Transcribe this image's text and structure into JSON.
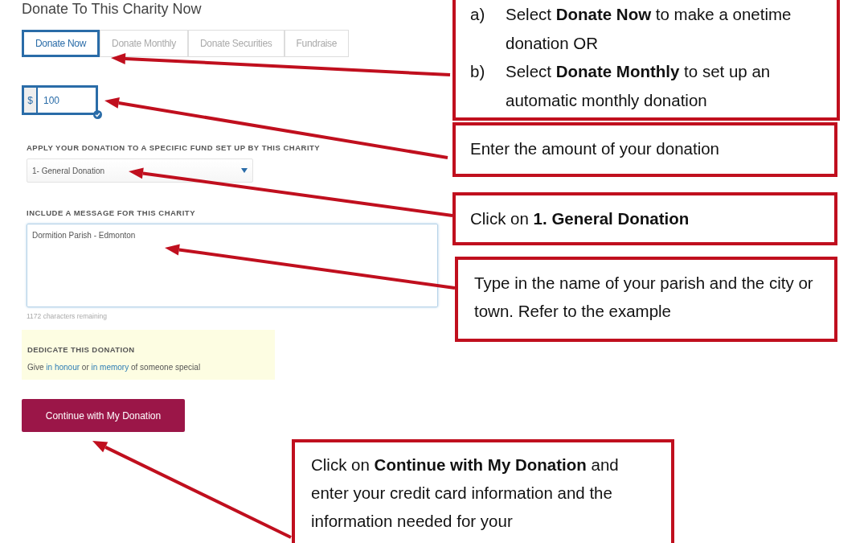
{
  "form": {
    "title": "Donate To This Charity Now",
    "tabs": [
      {
        "label": "Donate Now",
        "selected": true
      },
      {
        "label": "Donate Monthly",
        "selected": false
      },
      {
        "label": "Donate Securities",
        "selected": false
      },
      {
        "label": "Fundraise",
        "selected": false
      }
    ],
    "amount": {
      "prefix": "$",
      "value": "100",
      "valid": true
    },
    "fund": {
      "label": "APPLY YOUR DONATION TO A SPECIFIC FUND SET UP BY THIS CHARITY",
      "value": "1- General Donation"
    },
    "message": {
      "label": "INCLUDE A MESSAGE FOR THIS CHARITY",
      "value": "Dormition Parish  - Edmonton",
      "focused": true,
      "counter": "1172 characters remaining"
    },
    "dedicate": {
      "heading": "DEDICATE THIS DONATION",
      "parts": [
        {
          "kind": "text",
          "text": "Give "
        },
        {
          "kind": "link",
          "text": "in honour"
        },
        {
          "kind": "text",
          "text": " or "
        },
        {
          "kind": "link",
          "text": "in memory"
        },
        {
          "kind": "text",
          "text": " of someone special"
        }
      ]
    },
    "submit": "Continue with My Donation"
  },
  "callouts": [
    {
      "kind": "list",
      "items": [
        {
          "marker": "a)",
          "text": "Select **Donate Now** to make a onetime donation OR"
        },
        {
          "marker": "b)",
          "text": "Select **Donate Monthly** to set up an automatic monthly donation"
        }
      ]
    },
    {
      "kind": "text",
      "text": "Enter the amount of your donation"
    },
    {
      "kind": "text",
      "text": "Click on **1. General Donation**"
    },
    {
      "kind": "text",
      "text": "Type in the name of your parish and the city or town.  Refer to the example"
    },
    {
      "kind": "text",
      "text": "Click on **Continue with My Donation** and enter your credit card information and the information needed for your"
    }
  ]
}
